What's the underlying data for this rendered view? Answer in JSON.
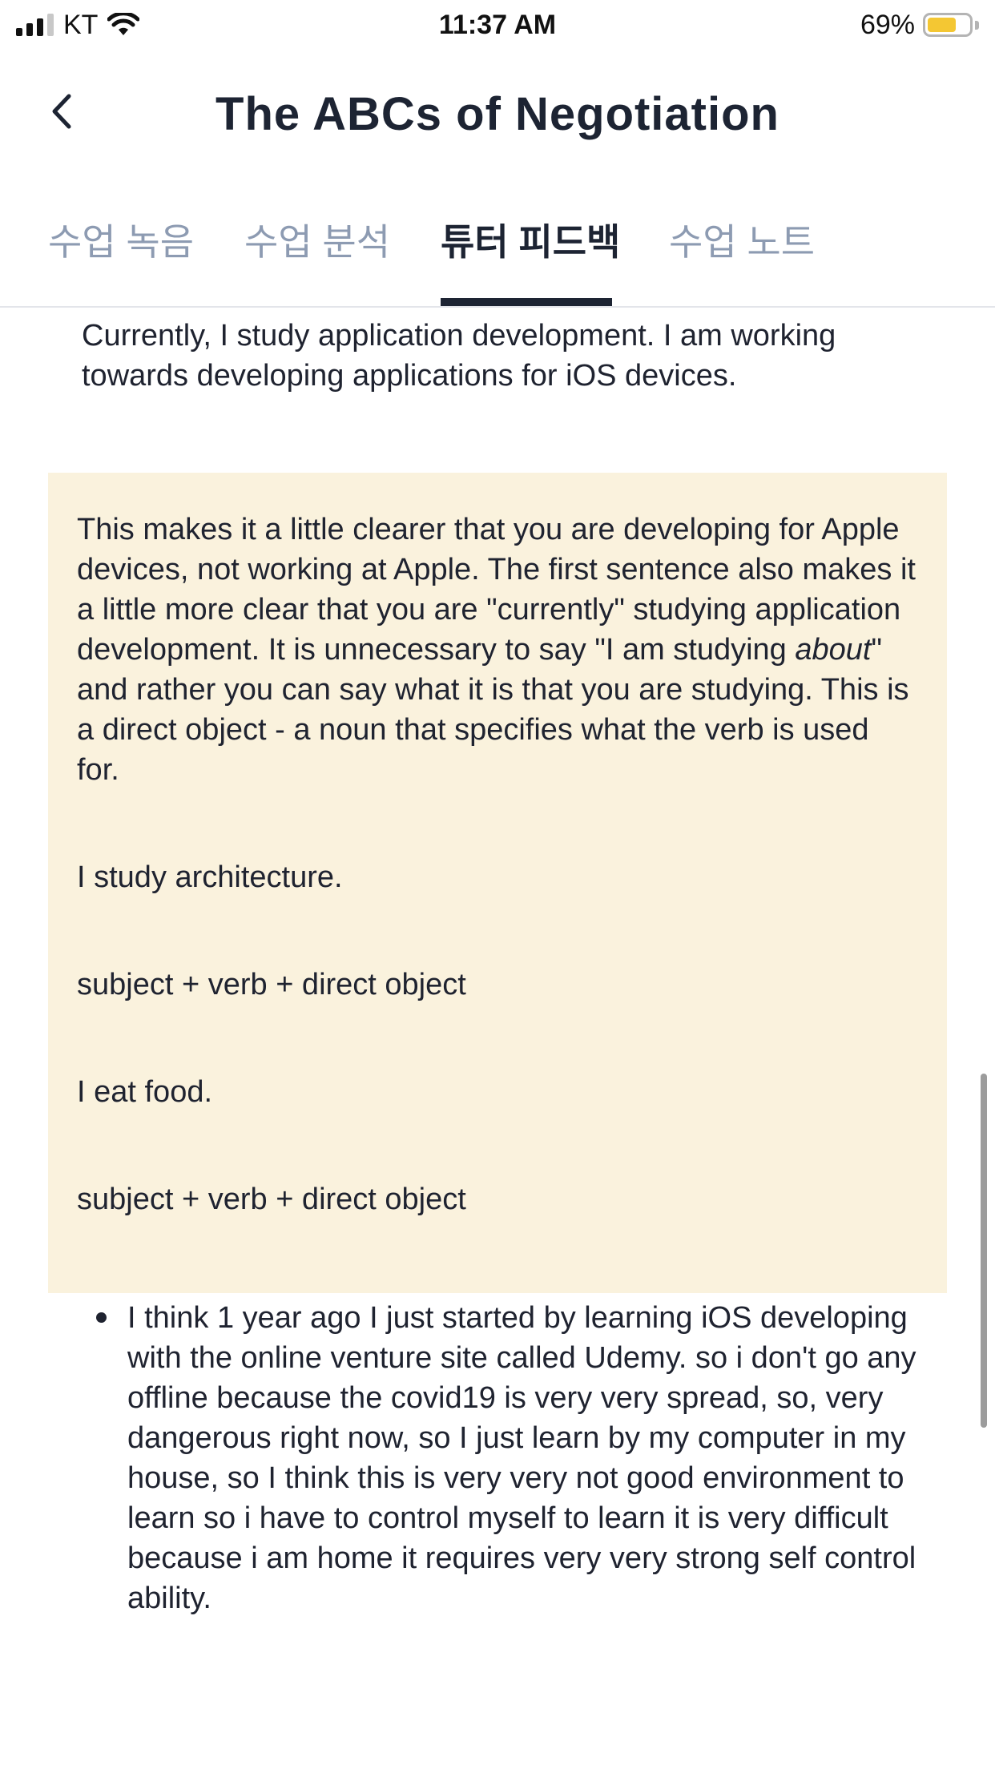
{
  "status_bar": {
    "carrier": "KT",
    "time": "11:37 AM",
    "battery_percent_label": "69%",
    "battery_level": 0.69,
    "battery_color": "#f4c733"
  },
  "header": {
    "back_icon": "chevron-left-icon",
    "title": "The ABCs of Negotiation"
  },
  "tabs": [
    {
      "label": "수업 녹음",
      "active": false
    },
    {
      "label": "수업 분석",
      "active": false
    },
    {
      "label": "튜터 피드백",
      "active": true
    },
    {
      "label": "수업 노트",
      "active": false
    }
  ],
  "content": {
    "corrected_text": "Currently, I study application development. I am working towards developing applications for iOS devices.",
    "feedback": {
      "explanation_part1": "This makes it a little clearer that you are developing for Apple devices, not working at Apple. The first sentence also makes it a little more clear that you are \"currently\" studying application development. It is unnecessary to say \"I am studying ",
      "explanation_em": "about",
      "explanation_part2": "\" and rather you can say what it is that you are studying. This is a direct object - a noun that specifies what the verb is used for.",
      "example1": "I study architecture.",
      "pattern1": "subject + verb + direct object",
      "example2": "I eat food.",
      "pattern2": "subject + verb + direct object",
      "background_color": "#faf2dd"
    },
    "bullet_text": "I think 1 year ago I just started by learning iOS developing with the online venture site called Udemy. so i don't go any offline because the covid19 is very very spread, so, very dangerous right now, so I just learn by my computer in my house, so I think this is very very not good environment to learn so i have to control myself to learn it is very difficult because i am home it requires very very strong self control ability."
  },
  "colors": {
    "accent": "#1d2433",
    "inactive_tab": "#8d9bb2"
  }
}
